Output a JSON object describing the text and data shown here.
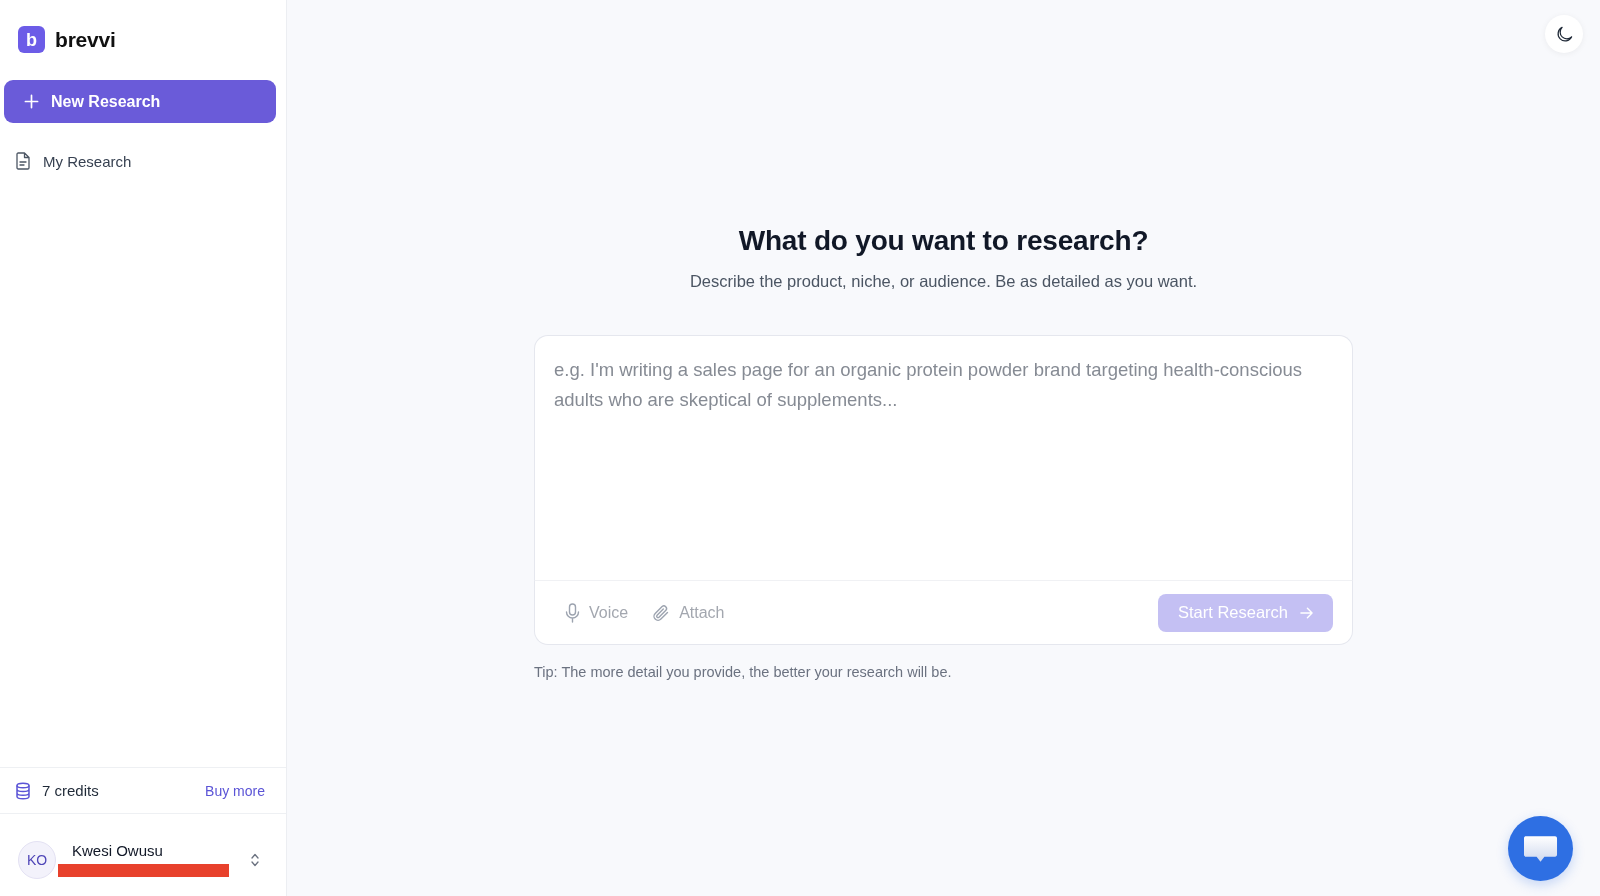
{
  "sidebar": {
    "logo": {
      "mark": "b",
      "name": "brevvi"
    },
    "new_button": {
      "label": "New Research"
    },
    "nav": [
      {
        "label": "My Research",
        "selected": false
      }
    ],
    "credits": {
      "count": "7 credits",
      "link": "Buy more"
    },
    "user": {
      "initials": "KO",
      "name": "Kwesi Owusu"
    }
  },
  "main": {
    "heading": "What do you want to research?",
    "subtitle": "Describe the product, niche, or audience. Be as detailed as you want.",
    "prompt": {
      "placeholder": "e.g. I'm writing a sales page for an organic protein powder brand targeting health-conscious adults who are skeptical of supplements..."
    },
    "tools": [
      {
        "label": "Voice",
        "kind": "voice"
      },
      {
        "label": "Attach",
        "kind": "attach"
      }
    ],
    "submit": {
      "label": "Start Research",
      "disabled": true
    },
    "tip": "Tip: The more detail you provide, the better your research will be."
  }
}
